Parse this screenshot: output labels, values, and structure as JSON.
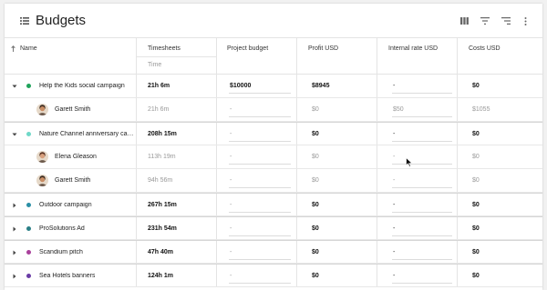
{
  "header": {
    "title": "Budgets",
    "icons": [
      "list-icon",
      "columns-icon",
      "filter-icon",
      "sort-icon",
      "more-vert-icon"
    ]
  },
  "columns": {
    "name": "Name",
    "timesheets": "Timesheets",
    "timesheets_sub": "Time",
    "project_budget": "Project budget",
    "profit": "Profit USD",
    "internal_rate": "Internal rate USD",
    "costs": "Costs USD"
  },
  "rows": [
    {
      "type": "project",
      "name": "Help the Kids social campaign",
      "dot_color": "#1fa35a",
      "expanded": true,
      "time": "21h 6m",
      "budget": "$10000",
      "profit": "$8945",
      "rate": "-",
      "costs": "$0"
    },
    {
      "type": "person",
      "name": "Garett Smith",
      "avatar": "man",
      "time": "21h 6m",
      "budget": "-",
      "profit": "$0",
      "rate": "$50",
      "costs": "$1055"
    },
    {
      "type": "project",
      "name": "Nature Channel anniversary cam...",
      "dot_color": "#6fd8c8",
      "expanded": true,
      "time": "208h 15m",
      "budget": "-",
      "profit": "$0",
      "rate": "-",
      "costs": "$0"
    },
    {
      "type": "person",
      "name": "Elena Gleason",
      "avatar": "woman",
      "time": "113h 19m",
      "budget": "-",
      "profit": "$0",
      "rate": "-",
      "costs": "$0"
    },
    {
      "type": "person",
      "name": "Garett Smith",
      "avatar": "man",
      "time": "94h 56m",
      "budget": "-",
      "profit": "$0",
      "rate": "-",
      "costs": "$0"
    },
    {
      "type": "project",
      "name": "Outdoor campaign",
      "dot_color": "#2a8fa6",
      "expanded": false,
      "time": "267h 15m",
      "budget": "-",
      "profit": "$0",
      "rate": "-",
      "costs": "$0"
    },
    {
      "type": "project",
      "name": "ProSolutions Ad",
      "dot_color": "#2a7f86",
      "expanded": false,
      "time": "231h 54m",
      "budget": "-",
      "profit": "$0",
      "rate": "-",
      "costs": "$0"
    },
    {
      "type": "project",
      "name": "Scandium pitch",
      "dot_color": "#a9409b",
      "expanded": false,
      "time": "47h 40m",
      "budget": "-",
      "profit": "$0",
      "rate": "-",
      "costs": "$0"
    },
    {
      "type": "project",
      "name": "Sea Hotels banners",
      "dot_color": "#6a3ca6",
      "expanded": false,
      "time": "124h 1m",
      "budget": "-",
      "profit": "$0",
      "rate": "-",
      "costs": "$0"
    }
  ]
}
